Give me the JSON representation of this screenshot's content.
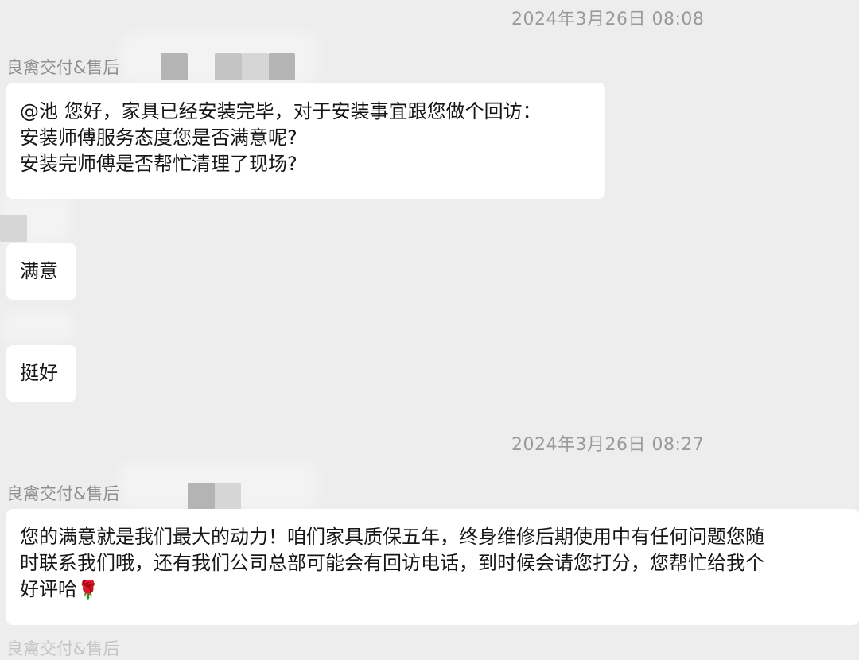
{
  "messages": [
    {
      "type": "timestamp",
      "text": "2024年3月26日 08:08"
    },
    {
      "type": "sender",
      "text": "良禽交付&售后"
    },
    {
      "type": "incoming",
      "lines": [
        "@池 您好，家具已经安装完毕，对于安装事宜跟您做个回访：",
        "安装师傅服务态度您是否满意呢?",
        "安装完师傅是否帮忙清理了现场?"
      ]
    },
    {
      "type": "incoming",
      "lines": [
        "满意"
      ]
    },
    {
      "type": "incoming",
      "lines": [
        "挺好"
      ]
    },
    {
      "type": "timestamp",
      "text": "2024年3月26日 08:27"
    },
    {
      "type": "sender",
      "text": "良禽交付&售后"
    },
    {
      "type": "incoming",
      "lines": [
        "您的满意就是我们最大的动力！咱们家具质保五年，终身维修后期使用中有任何问题您随",
        "时联系我们哦，还有我们公司总部可能会有回访电话，到时候会请您打分，您帮忙给我个",
        "好评哈"
      ],
      "trailing_emoji": "🌹"
    },
    {
      "type": "sender",
      "text": "良禽交付&售后"
    }
  ]
}
